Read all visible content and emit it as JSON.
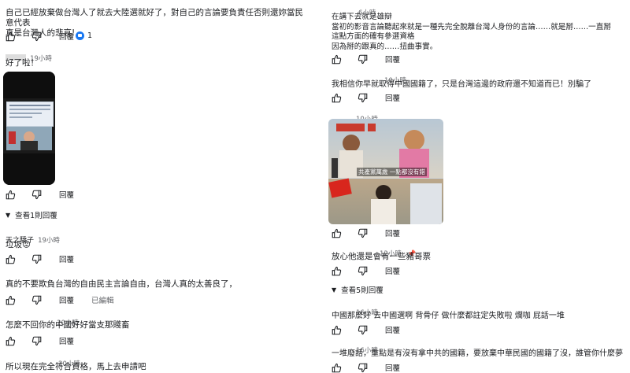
{
  "left": {
    "c1": {
      "text": "自己已經放棄做台灣人了就去大陸選就好了，對自己的言論要負責任否則還妳當民意代表\n真是台灣人的悲哀!",
      "likes": "1"
    },
    "c2": {
      "time": "19小時",
      "text": "好了啦！",
      "replies_label": "查看1則回覆"
    },
    "c3": {
      "name": "天之驕子",
      "time": "19小時",
      "text": "垃圾😡"
    },
    "c4": {
      "text": "真的不要欺負台灣的自由民主言論自由，台灣人真的太善良了，",
      "edited": "已編輯"
    },
    "c5": {
      "time": "20小時",
      "text": "怎麼不回你的中國好好當支那賤畜"
    },
    "c6": {
      "time": "20小時",
      "text": "所以現在完全符合資格，馬上去申請吧"
    }
  },
  "right": {
    "r1": {
      "time": "6小時",
      "text": "在講下去就是雄辯\n當初的影音言論聽起來就是一種先完全脫離台灣人身份的言論……就是掰……一直掰\n這點方面的確有參選資格\n因為掰的跟真的……扭曲事實。"
    },
    "r2": {
      "time": "10小時",
      "text": "我相信你早就取得中國國籍了，只是台灣這邊的政府還不知道而已！別騙了"
    },
    "r3": {
      "time": "10小時",
      "caption": "共產黨萬歲 一點都沒有錯"
    },
    "r4": {
      "time": "12小時",
      "text": "放心他還是會有一些豬哥票",
      "replies_label": "查看5則回覆"
    },
    "r5": {
      "time": "16小時",
      "text": "中國那麼好 去中國選啊 背骨仔 做什麼都註定失敗啦 爛咖 屁話一堆"
    },
    "r6": {
      "time": "16小時",
      "text": "一堆廢話，重點是有沒有拿中共的國籍，要放棄中華民國的國籍了沒，誰管你什麼夢"
    }
  },
  "reply_label": "回覆",
  "colors": {
    "accent": "#1877f2",
    "muted": "#65676b",
    "text": "#1c1e21"
  }
}
